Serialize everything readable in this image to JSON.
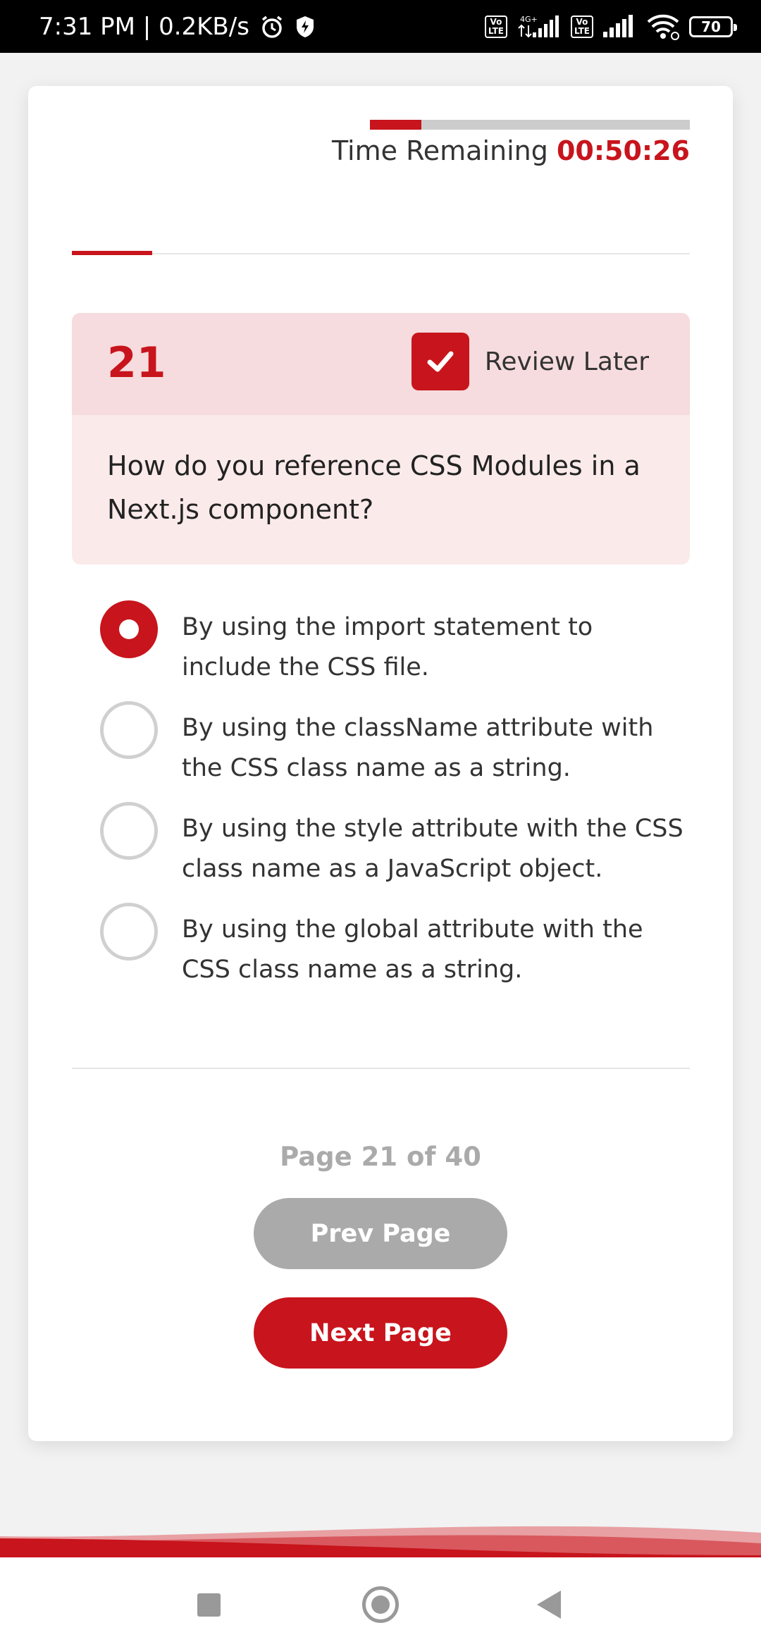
{
  "status_bar": {
    "time": "7:31 PM | 0.2KB/s",
    "network_label": "4G+",
    "volte_label": "Vo\nLTE",
    "battery": "70"
  },
  "timer": {
    "label": "Time Remaining",
    "value": "00:50:26",
    "progress_fraction": 0.16
  },
  "question": {
    "number": "21",
    "review_label": "Review Later",
    "review_checked": true,
    "text": "How do you reference CSS Modules in a Next.js component?"
  },
  "options": [
    {
      "text": "By using the import statement to include the CSS file.",
      "selected": true
    },
    {
      "text": "By using the className attribute with the CSS class name as a string.",
      "selected": false
    },
    {
      "text": "By using the style attribute with the CSS class name as a JavaScript object.",
      "selected": false
    },
    {
      "text": "By using the global attribute with the CSS class name as a string.",
      "selected": false
    }
  ],
  "pagination": {
    "indicator": "Page 21 of 40",
    "prev_label": "Prev Page",
    "next_label": "Next Page"
  },
  "colors": {
    "accent": "#c8141c",
    "disabled": "#aaaaaa"
  }
}
